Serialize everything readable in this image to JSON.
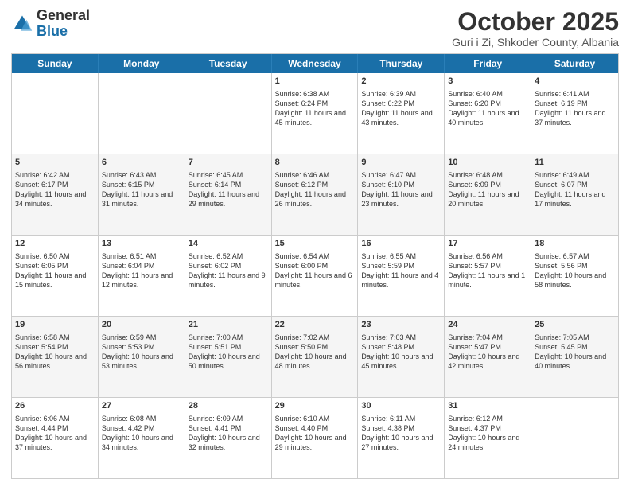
{
  "header": {
    "logo": {
      "general": "General",
      "blue": "Blue"
    },
    "title": "October 2025",
    "location": "Guri i Zi, Shkoder County, Albania"
  },
  "calendar": {
    "days": [
      "Sunday",
      "Monday",
      "Tuesday",
      "Wednesday",
      "Thursday",
      "Friday",
      "Saturday"
    ],
    "rows": [
      [
        {
          "day": "",
          "info": ""
        },
        {
          "day": "",
          "info": ""
        },
        {
          "day": "",
          "info": ""
        },
        {
          "day": "1",
          "info": "Sunrise: 6:38 AM\nSunset: 6:24 PM\nDaylight: 11 hours and 45 minutes."
        },
        {
          "day": "2",
          "info": "Sunrise: 6:39 AM\nSunset: 6:22 PM\nDaylight: 11 hours and 43 minutes."
        },
        {
          "day": "3",
          "info": "Sunrise: 6:40 AM\nSunset: 6:20 PM\nDaylight: 11 hours and 40 minutes."
        },
        {
          "day": "4",
          "info": "Sunrise: 6:41 AM\nSunset: 6:19 PM\nDaylight: 11 hours and 37 minutes."
        }
      ],
      [
        {
          "day": "5",
          "info": "Sunrise: 6:42 AM\nSunset: 6:17 PM\nDaylight: 11 hours and 34 minutes."
        },
        {
          "day": "6",
          "info": "Sunrise: 6:43 AM\nSunset: 6:15 PM\nDaylight: 11 hours and 31 minutes."
        },
        {
          "day": "7",
          "info": "Sunrise: 6:45 AM\nSunset: 6:14 PM\nDaylight: 11 hours and 29 minutes."
        },
        {
          "day": "8",
          "info": "Sunrise: 6:46 AM\nSunset: 6:12 PM\nDaylight: 11 hours and 26 minutes."
        },
        {
          "day": "9",
          "info": "Sunrise: 6:47 AM\nSunset: 6:10 PM\nDaylight: 11 hours and 23 minutes."
        },
        {
          "day": "10",
          "info": "Sunrise: 6:48 AM\nSunset: 6:09 PM\nDaylight: 11 hours and 20 minutes."
        },
        {
          "day": "11",
          "info": "Sunrise: 6:49 AM\nSunset: 6:07 PM\nDaylight: 11 hours and 17 minutes."
        }
      ],
      [
        {
          "day": "12",
          "info": "Sunrise: 6:50 AM\nSunset: 6:05 PM\nDaylight: 11 hours and 15 minutes."
        },
        {
          "day": "13",
          "info": "Sunrise: 6:51 AM\nSunset: 6:04 PM\nDaylight: 11 hours and 12 minutes."
        },
        {
          "day": "14",
          "info": "Sunrise: 6:52 AM\nSunset: 6:02 PM\nDaylight: 11 hours and 9 minutes."
        },
        {
          "day": "15",
          "info": "Sunrise: 6:54 AM\nSunset: 6:00 PM\nDaylight: 11 hours and 6 minutes."
        },
        {
          "day": "16",
          "info": "Sunrise: 6:55 AM\nSunset: 5:59 PM\nDaylight: 11 hours and 4 minutes."
        },
        {
          "day": "17",
          "info": "Sunrise: 6:56 AM\nSunset: 5:57 PM\nDaylight: 11 hours and 1 minute."
        },
        {
          "day": "18",
          "info": "Sunrise: 6:57 AM\nSunset: 5:56 PM\nDaylight: 10 hours and 58 minutes."
        }
      ],
      [
        {
          "day": "19",
          "info": "Sunrise: 6:58 AM\nSunset: 5:54 PM\nDaylight: 10 hours and 56 minutes."
        },
        {
          "day": "20",
          "info": "Sunrise: 6:59 AM\nSunset: 5:53 PM\nDaylight: 10 hours and 53 minutes."
        },
        {
          "day": "21",
          "info": "Sunrise: 7:00 AM\nSunset: 5:51 PM\nDaylight: 10 hours and 50 minutes."
        },
        {
          "day": "22",
          "info": "Sunrise: 7:02 AM\nSunset: 5:50 PM\nDaylight: 10 hours and 48 minutes."
        },
        {
          "day": "23",
          "info": "Sunrise: 7:03 AM\nSunset: 5:48 PM\nDaylight: 10 hours and 45 minutes."
        },
        {
          "day": "24",
          "info": "Sunrise: 7:04 AM\nSunset: 5:47 PM\nDaylight: 10 hours and 42 minutes."
        },
        {
          "day": "25",
          "info": "Sunrise: 7:05 AM\nSunset: 5:45 PM\nDaylight: 10 hours and 40 minutes."
        }
      ],
      [
        {
          "day": "26",
          "info": "Sunrise: 6:06 AM\nSunset: 4:44 PM\nDaylight: 10 hours and 37 minutes."
        },
        {
          "day": "27",
          "info": "Sunrise: 6:08 AM\nSunset: 4:42 PM\nDaylight: 10 hours and 34 minutes."
        },
        {
          "day": "28",
          "info": "Sunrise: 6:09 AM\nSunset: 4:41 PM\nDaylight: 10 hours and 32 minutes."
        },
        {
          "day": "29",
          "info": "Sunrise: 6:10 AM\nSunset: 4:40 PM\nDaylight: 10 hours and 29 minutes."
        },
        {
          "day": "30",
          "info": "Sunrise: 6:11 AM\nSunset: 4:38 PM\nDaylight: 10 hours and 27 minutes."
        },
        {
          "day": "31",
          "info": "Sunrise: 6:12 AM\nSunset: 4:37 PM\nDaylight: 10 hours and 24 minutes."
        },
        {
          "day": "",
          "info": ""
        }
      ]
    ]
  }
}
